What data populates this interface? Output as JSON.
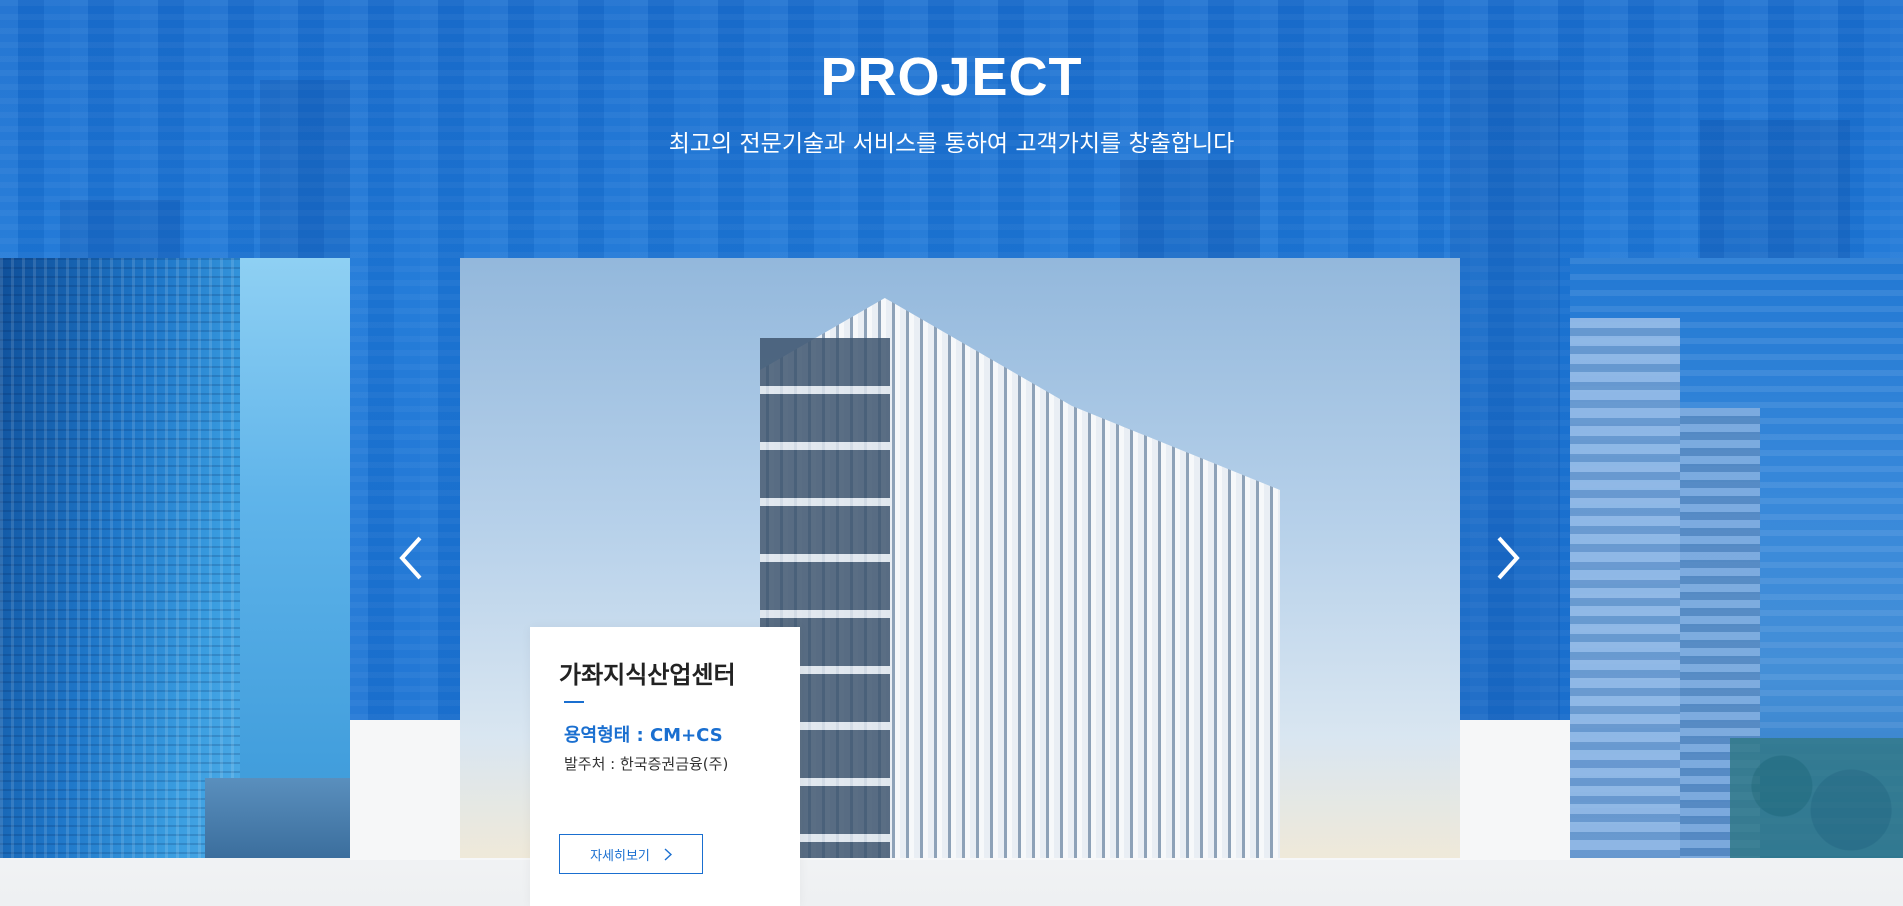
{
  "section": {
    "title": "PROJECT",
    "subtitle": "최고의 전문기술과 서비스를 통하여 고객가치를 창출합니다"
  },
  "carousel": {
    "prev_icon": "chevron-left-icon",
    "next_icon": "chevron-right-icon",
    "active_slide": {
      "name": "가좌지식산업센터",
      "service_type": "용역형태 : CM+CS",
      "client": "발주처 : 한국증권금융(주)",
      "detail_button_label": "자세히보기",
      "detail_button_icon": "chevron-right-icon"
    }
  },
  "colors": {
    "accent": "#1a6fd0",
    "hero_blue": "#1d78d8",
    "card_bg": "#ffffff",
    "title_text": "#222222"
  }
}
